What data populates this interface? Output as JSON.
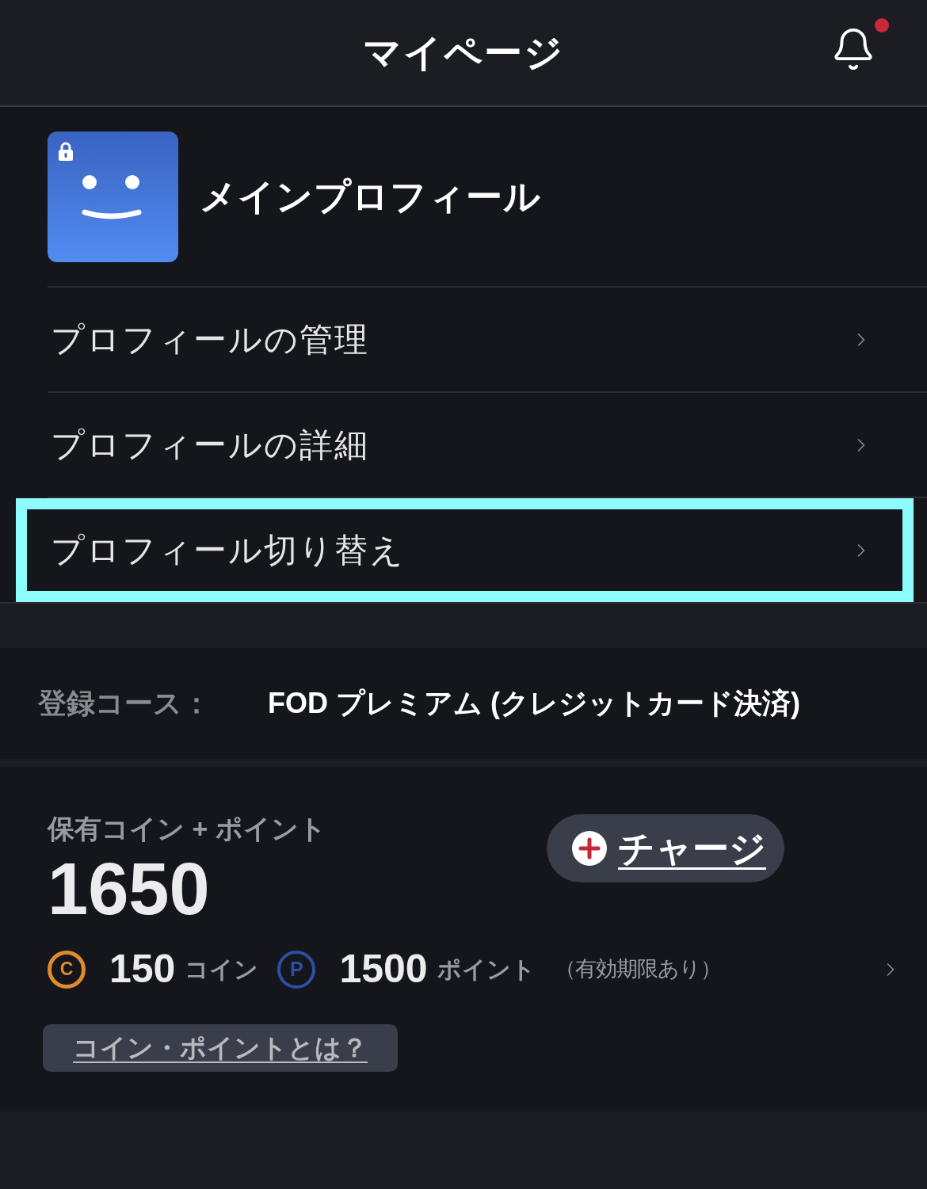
{
  "header": {
    "title": "マイページ",
    "notification_badge": true
  },
  "profile": {
    "name": "メインプロフィール",
    "locked": true
  },
  "menu": [
    {
      "label": "プロフィールの管理",
      "highlighted": false
    },
    {
      "label": "プロフィールの詳細",
      "highlighted": false
    },
    {
      "label": "プロフィール切り替え",
      "highlighted": true
    }
  ],
  "course": {
    "label": "登録コース：",
    "value": "FOD プレミアム (クレジットカード決済)"
  },
  "balance": {
    "label": "保有コイン + ポイント",
    "total": "1650",
    "charge_button": "チャージ",
    "items": [
      {
        "kind": "coin",
        "symbol": "C",
        "color": "#e08a2e",
        "amount": "150",
        "unit": "コイン"
      },
      {
        "kind": "point",
        "symbol": "P",
        "color": "#2d4fa3",
        "amount": "1500",
        "unit": "ポイント",
        "note": "（有効期限あり）"
      }
    ],
    "help_button": "コイン・ポイントとは？"
  }
}
